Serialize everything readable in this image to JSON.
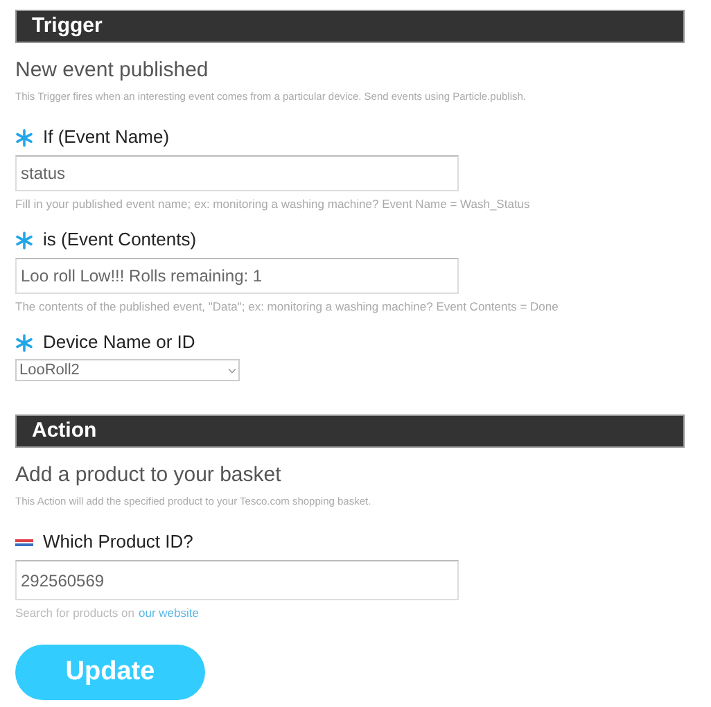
{
  "sections": [
    {
      "header": "Trigger",
      "title": "New event published",
      "description": "This Trigger fires when an interesting event comes from a particular device. Send events using Particle.publish.",
      "fields": [
        {
          "label": "If (Event Name)",
          "kind": "text",
          "value": "status",
          "hint": "Fill in your published event name; ex: monitoring a washing machine? Event Name = Wash_Status"
        },
        {
          "label": "is (Event Contents)",
          "kind": "text",
          "value": "Loo roll Low!!! Rolls remaining: 1",
          "hint": "The contents of the published event, \"Data\"; ex: monitoring a washing machine? Event Contents = Done"
        },
        {
          "label": "Device Name or ID",
          "kind": "select",
          "value": "LooRoll2"
        }
      ]
    },
    {
      "header": "Action",
      "title": "Add a product to your basket",
      "description": "This Action will add the specified product to your Tesco.com shopping basket.",
      "fields": [
        {
          "label": "Which Product ID?",
          "kind": "text",
          "value": "292560569",
          "hint": "Search for products on",
          "hint_link": "our website"
        }
      ]
    }
  ],
  "button": "Update"
}
